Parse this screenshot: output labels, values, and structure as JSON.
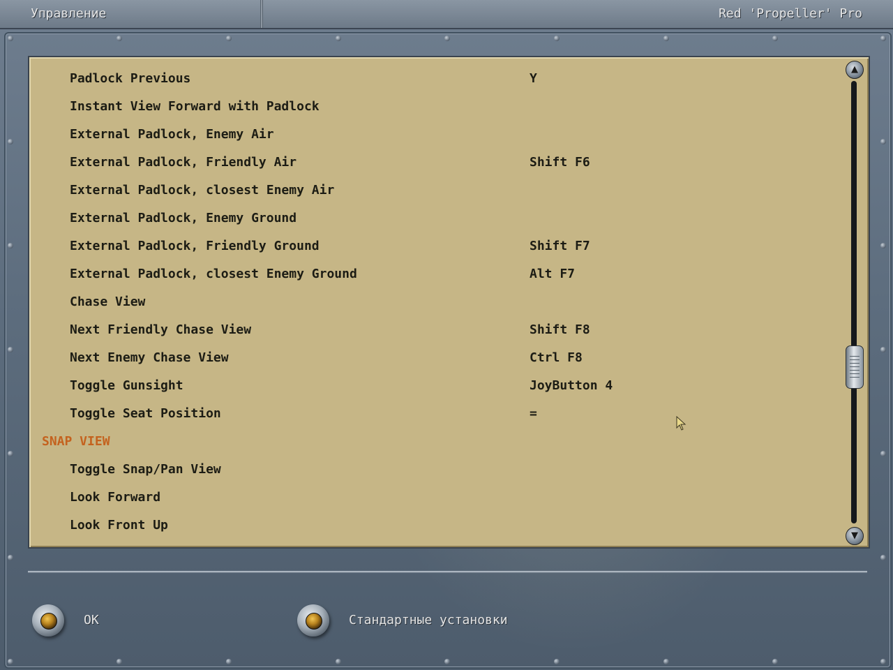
{
  "window": {
    "title_left": "Управление",
    "title_right": "Red 'Propeller' Pro"
  },
  "bindings": [
    {
      "type": "item",
      "action": "Padlock Previous",
      "key": "Y"
    },
    {
      "type": "item",
      "action": "Instant View Forward with Padlock",
      "key": ""
    },
    {
      "type": "item",
      "action": "External Padlock, Enemy Air",
      "key": ""
    },
    {
      "type": "item",
      "action": "External Padlock, Friendly Air",
      "key": "Shift F6"
    },
    {
      "type": "item",
      "action": "External Padlock, closest Enemy Air",
      "key": ""
    },
    {
      "type": "item",
      "action": "External Padlock, Enemy Ground",
      "key": ""
    },
    {
      "type": "item",
      "action": "External Padlock, Friendly Ground",
      "key": "Shift F7"
    },
    {
      "type": "item",
      "action": "External Padlock, closest Enemy Ground",
      "key": "Alt F7"
    },
    {
      "type": "item",
      "action": "Chase View",
      "key": ""
    },
    {
      "type": "item",
      "action": "Next Friendly Chase View",
      "key": "Shift F8"
    },
    {
      "type": "item",
      "action": "Next Enemy Chase View",
      "key": "Ctrl F8"
    },
    {
      "type": "item",
      "action": "Toggle Gunsight",
      "key": "JoyButton 4"
    },
    {
      "type": "item",
      "action": "Toggle Seat Position",
      "key": "="
    },
    {
      "type": "section",
      "action": "SNAP VIEW",
      "key": ""
    },
    {
      "type": "item",
      "action": "Toggle Snap/Pan View",
      "key": ""
    },
    {
      "type": "item",
      "action": "Look Forward",
      "key": ""
    },
    {
      "type": "item",
      "action": "Look Front Up",
      "key": ""
    }
  ],
  "scrollbar": {
    "up_icon": "arrow-up-icon",
    "down_icon": "arrow-down-icon",
    "position_fraction": 0.66
  },
  "buttons": {
    "ok_label": "OK",
    "defaults_label": "Стандартные установки"
  },
  "colors": {
    "list_background": "#c6b686",
    "section_header": "#c4621e",
    "text": "#1c1c14"
  }
}
